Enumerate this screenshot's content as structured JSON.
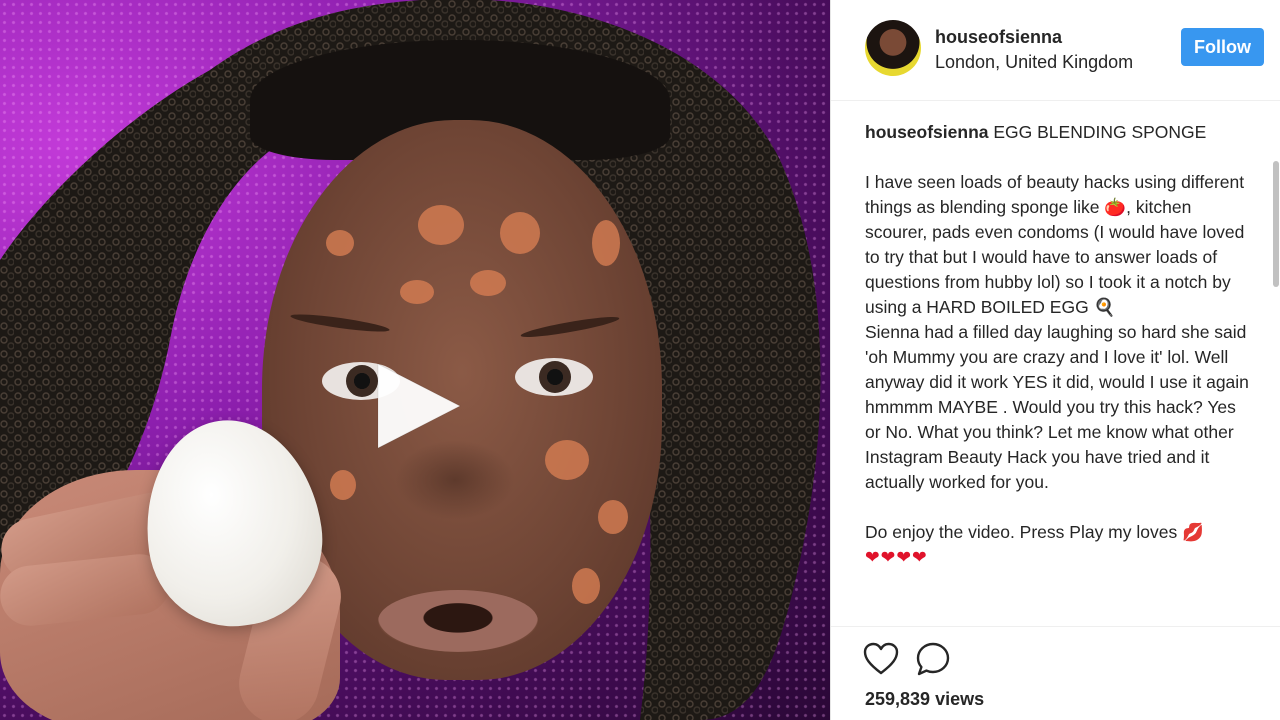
{
  "post": {
    "username": "houseofsienna",
    "location": "London, United Kingdom",
    "follow_label": "Follow"
  },
  "caption": {
    "username": "houseofsienna",
    "headline": "EGG BLENDING SPONGE",
    "paragraph1": "I have seen loads of beauty hacks using different things as blending sponge like 🍅, kitchen scourer, pads even condoms (I would have loved to try that but I would have to answer loads of questions from hubby lol) so I took it a notch by using a HARD BOILED EGG 🍳",
    "paragraph2": "Sienna had a filled day laughing so hard she said 'oh Mummy you are crazy and I love it' lol. Well anyway did it work YES it did, would I use it again hmmmm MAYBE . Would you try this hack? Yes or No. What you think? Let me know what other Instagram Beauty Hack you have tried and it actually worked for you.",
    "paragraph3": "Do enjoy the video. Press Play my loves 💋",
    "hearts": "❤❤❤❤"
  },
  "stats": {
    "views": "259,839 views"
  },
  "icons": {
    "play": "play-icon",
    "like": "heart-icon",
    "comment": "comment-icon"
  },
  "colors": {
    "follow_button": "#3897f0",
    "text": "#262626",
    "heart": "#e0132b"
  }
}
